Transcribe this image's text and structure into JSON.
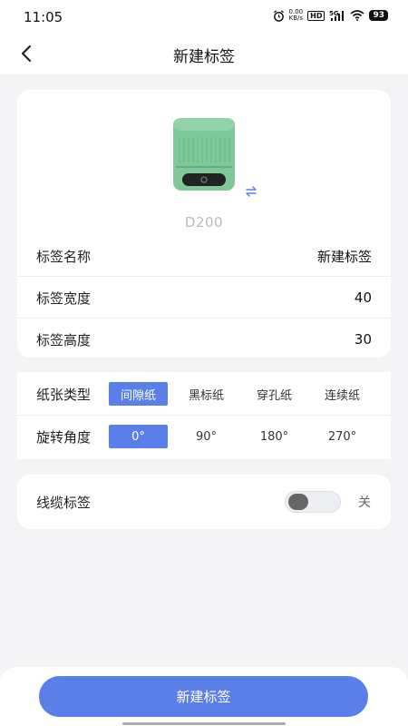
{
  "status_bar": {
    "time": "11:05",
    "net_speed_value": "0.00",
    "net_speed_unit": "KB/s",
    "hd_label": "HD",
    "signal_label": "5G",
    "battery": "93",
    "icons": [
      "alarm-icon",
      "signal-icon",
      "wifi-icon",
      "battery-icon"
    ]
  },
  "nav": {
    "title": "新建标签",
    "back_icon": "chevron-left-icon"
  },
  "device": {
    "name": "D200",
    "image": "label-printer",
    "swap_icon": "swap-icon"
  },
  "fields": [
    {
      "label": "标签名称",
      "value": "新建标签"
    },
    {
      "label": "标签宽度",
      "value": "40"
    },
    {
      "label": "标签高度",
      "value": "30"
    }
  ],
  "paper_type": {
    "label": "纸张类型",
    "options": [
      "间隙纸",
      "黑标纸",
      "穿孔纸",
      "连续纸"
    ],
    "selected": "间隙纸"
  },
  "rotation": {
    "label": "旋转角度",
    "options": [
      "0°",
      "90°",
      "180°",
      "270°"
    ],
    "selected": "0°"
  },
  "cable_label": {
    "label": "线缆标签",
    "enabled": false,
    "state_text": "关"
  },
  "footer": {
    "create_button": "新建标签"
  },
  "colors": {
    "accent": "#5b7fe9",
    "background": "#f4f4f6",
    "card": "#ffffff",
    "device_body": "#7fc89a"
  }
}
